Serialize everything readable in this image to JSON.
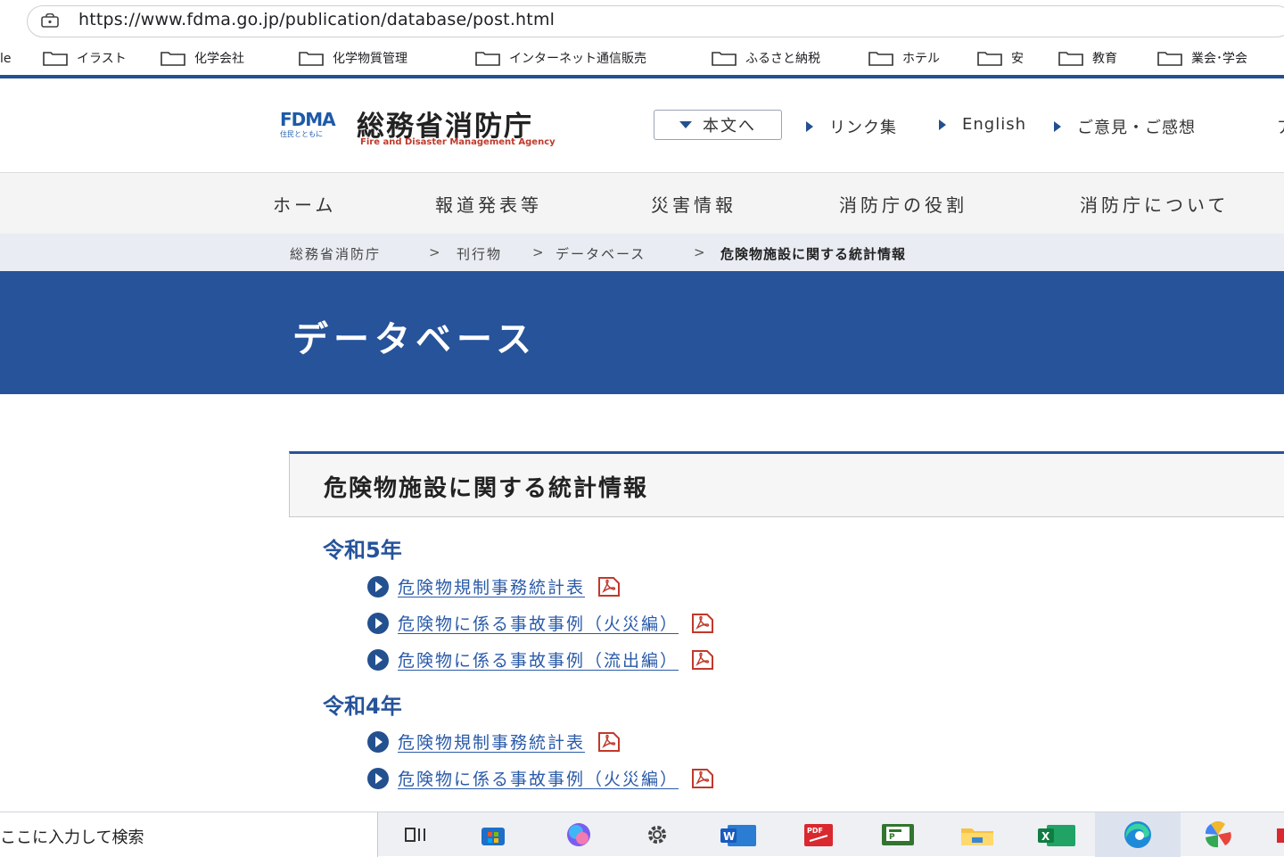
{
  "browser": {
    "url": "https://www.fdma.go.jp/publication/database/post.html",
    "bookmarks_cut": "le",
    "bookmarks": [
      "イラスト",
      "化学会社",
      "化学物質管理",
      "インターネット通信販売",
      "ふるさと納税",
      "ホテル",
      "安",
      "教育",
      "業会･学会"
    ]
  },
  "header": {
    "logo_fdma": "FDMA",
    "logo_fdma_sub": "住民とともに",
    "logo_name": "総務省消防庁",
    "logo_en": "Fire and Disaster Management Agency",
    "honbun_label": "本文へ",
    "links": [
      "リンク集",
      "English",
      "ご意見・ご感想"
    ],
    "cut_text": "ア"
  },
  "nav": [
    "ホーム",
    "報道発表等",
    "災害情報",
    "消防庁の役割",
    "消防庁について"
  ],
  "breadcrumb": [
    "総務省消防庁",
    "刊行物",
    "データベース",
    "危険物施設に関する統計情報"
  ],
  "breadcrumb_sep": ">",
  "page_title": "データベース",
  "section_title": "危険物施設に関する統計情報",
  "years": [
    {
      "label": "令和5年",
      "docs": [
        "危険物規制事務統計表",
        "危険物に係る事故事例（火災編）",
        "危険物に係る事故事例（流出編）"
      ]
    },
    {
      "label": "令和4年",
      "docs": [
        "危険物規制事務統計表",
        "危険物に係る事故事例（火災編）"
      ]
    }
  ],
  "taskbar": {
    "search_text": "ここに入力して検索",
    "icons": [
      "task-view-icon",
      "store-icon",
      "copilot-icon",
      "settings-icon",
      "word-icon",
      "pdf-app-icon",
      "project-icon",
      "file-explorer-icon",
      "excel-icon",
      "edge-icon",
      "photos-icon"
    ]
  },
  "colors": {
    "brand_blue": "#26539a",
    "link_blue": "#2a5aa8",
    "pdf_red": "#c0392b"
  }
}
